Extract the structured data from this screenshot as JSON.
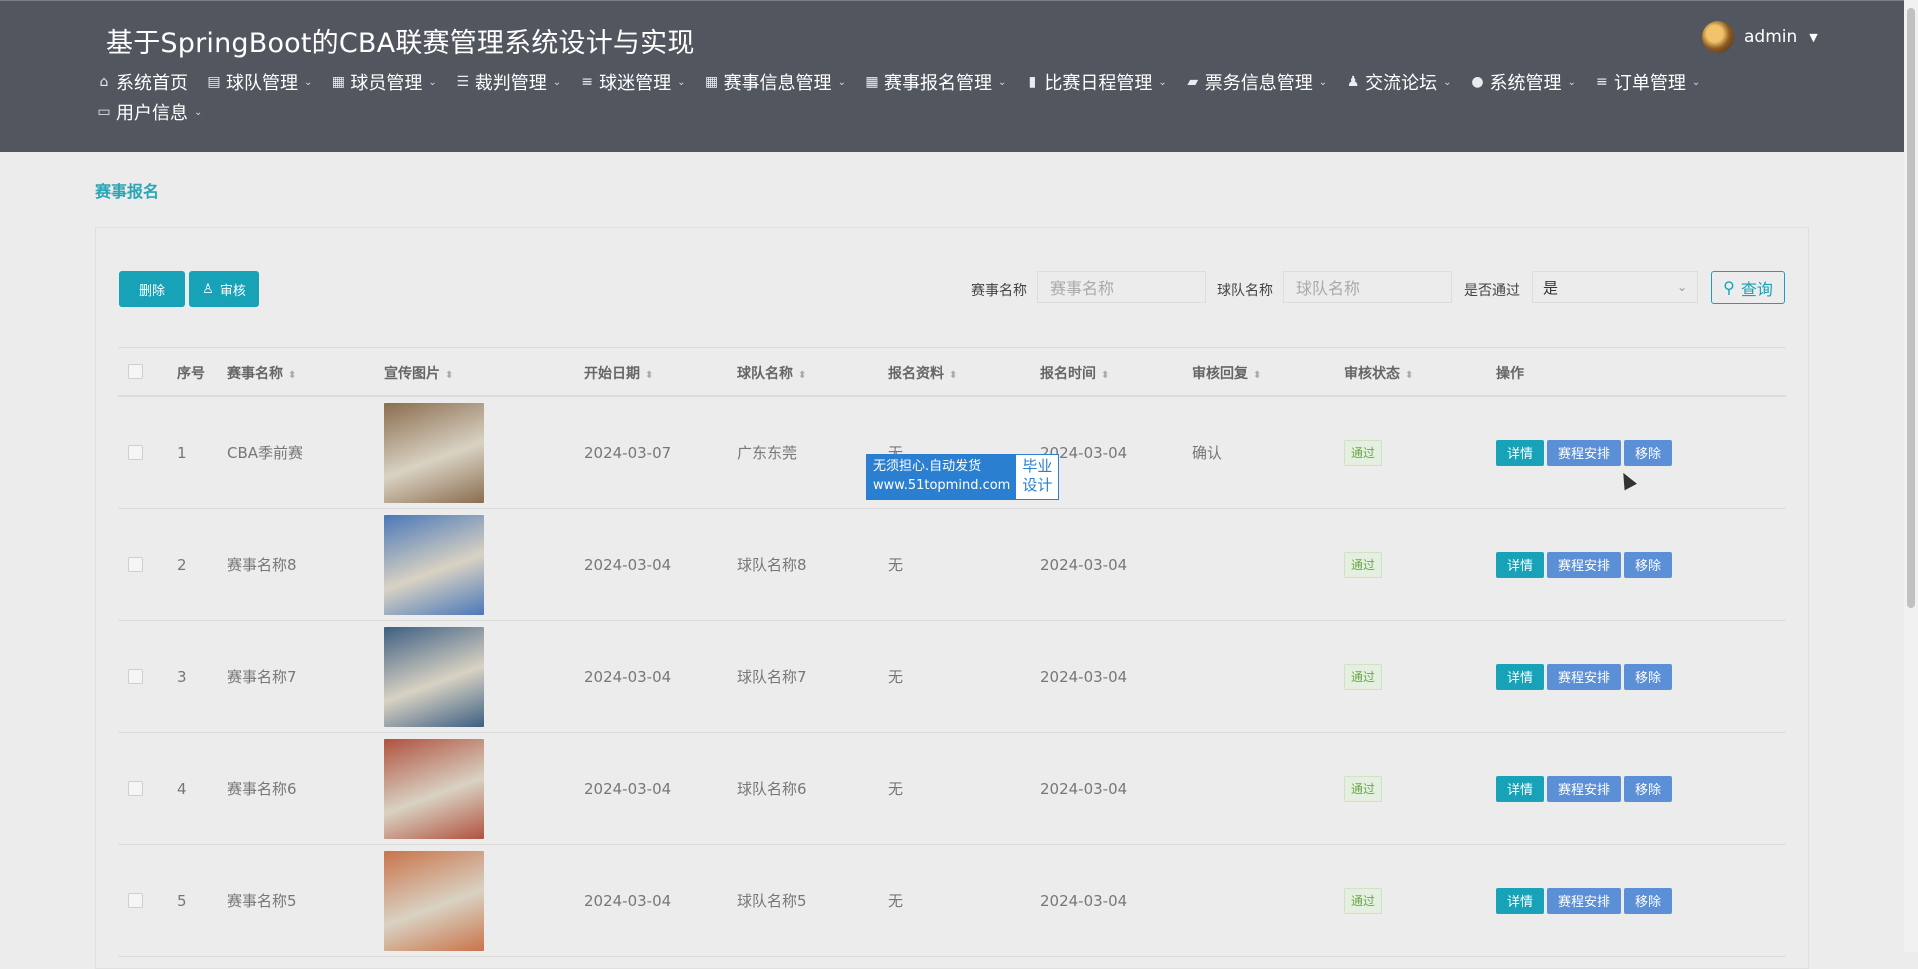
{
  "app": {
    "title": "基于SpringBoot的CBA联赛管理系统设计与实现"
  },
  "user": {
    "name": "admin"
  },
  "nav": [
    {
      "label": "系统首页",
      "icon": "home-icon",
      "glyph": "⌂",
      "dropdown": false
    },
    {
      "label": "球队管理",
      "icon": "clipboard-icon",
      "glyph": "▤",
      "dropdown": true
    },
    {
      "label": "球员管理",
      "icon": "grid-icon",
      "glyph": "▦",
      "dropdown": true
    },
    {
      "label": "裁判管理",
      "icon": "sliders-icon",
      "glyph": "☰",
      "dropdown": true
    },
    {
      "label": "球迷管理",
      "icon": "list-icon",
      "glyph": "≡",
      "dropdown": true
    },
    {
      "label": "赛事信息管理",
      "icon": "grid-icon",
      "glyph": "▦",
      "dropdown": true
    },
    {
      "label": "赛事报名管理",
      "icon": "grid-icon",
      "glyph": "▦",
      "dropdown": true
    },
    {
      "label": "比赛日程管理",
      "icon": "bar-chart-icon",
      "glyph": "▮",
      "dropdown": true
    },
    {
      "label": "票务信息管理",
      "icon": "briefcase-icon",
      "glyph": "▰",
      "dropdown": true
    },
    {
      "label": "交流论坛",
      "icon": "user-icon",
      "glyph": "♟",
      "dropdown": true
    },
    {
      "label": "系统管理",
      "icon": "map-pin-icon",
      "glyph": "●",
      "dropdown": true
    },
    {
      "label": "订单管理",
      "icon": "list-icon",
      "glyph": "≡",
      "dropdown": true
    },
    {
      "label": "用户信息",
      "icon": "id-card-icon",
      "glyph": "▭",
      "dropdown": true
    }
  ],
  "page": {
    "breadcrumb": "赛事报名"
  },
  "toolbar": {
    "delete_label": "删除",
    "audit_label": "审核"
  },
  "filters": {
    "event_name_label": "赛事名称",
    "event_name_placeholder": "赛事名称",
    "team_name_label": "球队名称",
    "team_name_placeholder": "球队名称",
    "passed_label": "是否通过",
    "passed_value": "是",
    "query_label": "查询"
  },
  "table": {
    "headers": {
      "index": "序号",
      "event_name": "赛事名称",
      "poster": "宣传图片",
      "start_date": "开始日期",
      "team_name": "球队名称",
      "materials": "报名资料",
      "signup_time": "报名时间",
      "audit_reply": "审核回复",
      "audit_status": "审核状态",
      "actions": "操作"
    },
    "rows": [
      {
        "index": "1",
        "event_name": "CBA季前赛",
        "start_date": "2024-03-07",
        "team_name": "广东东莞",
        "materials": "无",
        "signup_time": "2024-03-04",
        "audit_reply": "确认",
        "audit_status": "通过",
        "poster_color": "#8a6d4f"
      },
      {
        "index": "2",
        "event_name": "赛事名称8",
        "start_date": "2024-03-04",
        "team_name": "球队名称8",
        "materials": "无",
        "signup_time": "2024-03-04",
        "audit_reply": "",
        "audit_status": "通过",
        "poster_color": "#4a78b8"
      },
      {
        "index": "3",
        "event_name": "赛事名称7",
        "start_date": "2024-03-04",
        "team_name": "球队名称7",
        "materials": "无",
        "signup_time": "2024-03-04",
        "audit_reply": "",
        "audit_status": "通过",
        "poster_color": "#3d5f82"
      },
      {
        "index": "4",
        "event_name": "赛事名称6",
        "start_date": "2024-03-04",
        "team_name": "球队名称6",
        "materials": "无",
        "signup_time": "2024-03-04",
        "audit_reply": "",
        "audit_status": "通过",
        "poster_color": "#b0523e"
      },
      {
        "index": "5",
        "event_name": "赛事名称5",
        "start_date": "2024-03-04",
        "team_name": "球队名称5",
        "materials": "无",
        "signup_time": "2024-03-04",
        "audit_reply": "",
        "audit_status": "通过",
        "poster_color": "#c9744a"
      }
    ],
    "row_actions": {
      "detail": "详情",
      "schedule": "赛程安排",
      "remove": "移除"
    }
  },
  "watermark": {
    "line1": "无须担心.自动发货",
    "line2": "www.51topmind.com",
    "right1": "毕业",
    "right2": "设计"
  },
  "colors": {
    "header": "#51565f",
    "accent": "#17a2b8",
    "blue_button": "#5b8fd6",
    "badge": "#6aa84f"
  }
}
